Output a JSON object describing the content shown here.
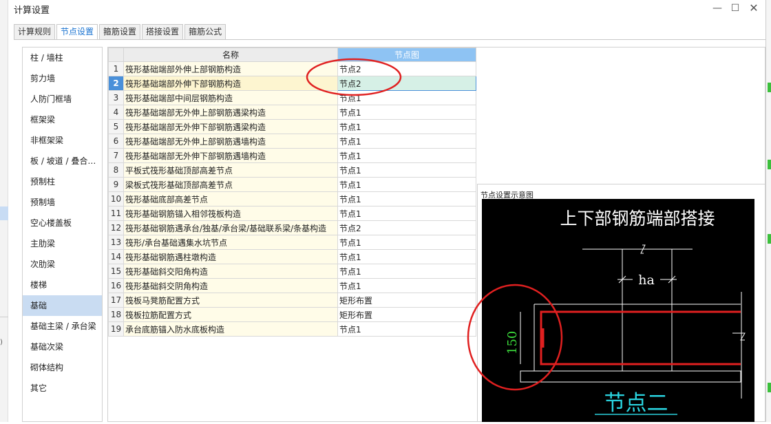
{
  "window": {
    "title": "计算设置"
  },
  "tabs": [
    "计算规则",
    "节点设置",
    "箍筋设置",
    "搭接设置",
    "箍筋公式"
  ],
  "sidebar": [
    "柱 / 墙柱",
    "剪力墙",
    "人防门框墙",
    "框架梁",
    "非框架梁",
    "板 / 坡道 / 叠合…",
    "预制柱",
    "预制墙",
    "空心楼盖板",
    "主肋梁",
    "次肋梁",
    "楼梯",
    "基础",
    "基础主梁 / 承台梁",
    "基础次梁",
    "砌体结构",
    "其它"
  ],
  "grid": {
    "headers": {
      "name": "名称",
      "value": "节点图"
    },
    "rows": [
      {
        "n": "1",
        "name": "筏形基础端部外伸上部钢筋构造",
        "value": "节点2"
      },
      {
        "n": "2",
        "name": "筏形基础端部外伸下部钢筋构造",
        "value": "节点2"
      },
      {
        "n": "3",
        "name": "筏形基础端部中间层钢筋构造",
        "value": "节点1"
      },
      {
        "n": "4",
        "name": "筏形基础端部无外伸上部钢筋遇梁构造",
        "value": "节点1"
      },
      {
        "n": "5",
        "name": "筏形基础端部无外伸下部钢筋遇梁构造",
        "value": "节点1"
      },
      {
        "n": "6",
        "name": "筏形基础端部无外伸上部钢筋遇墙构造",
        "value": "节点1"
      },
      {
        "n": "7",
        "name": "筏形基础端部无外伸下部钢筋遇墙构造",
        "value": "节点1"
      },
      {
        "n": "8",
        "name": "平板式筏形基础顶部高差节点",
        "value": "节点1"
      },
      {
        "n": "9",
        "name": "梁板式筏形基础顶部高差节点",
        "value": "节点1"
      },
      {
        "n": "10",
        "name": "筏形基础底部高差节点",
        "value": "节点1"
      },
      {
        "n": "11",
        "name": "筏形基础钢筋锚入相邻筏板构造",
        "value": "节点1"
      },
      {
        "n": "12",
        "name": "筏形基础钢筋遇承台/独基/承台梁/基础联系梁/条基构造",
        "value": "节点2"
      },
      {
        "n": "13",
        "name": "筏形/承台基础遇集水坑节点",
        "value": "节点1"
      },
      {
        "n": "14",
        "name": "筏形基础钢筋遇柱墩构造",
        "value": "节点1"
      },
      {
        "n": "15",
        "name": "筏形基础斜交阳角构造",
        "value": "节点1"
      },
      {
        "n": "16",
        "name": "筏形基础斜交阴角构造",
        "value": "节点1"
      },
      {
        "n": "17",
        "name": "筏板马凳筋配置方式",
        "value": "矩形布置"
      },
      {
        "n": "18",
        "name": "筏板拉筋配置方式",
        "value": "矩形布置"
      },
      {
        "n": "19",
        "name": "承台底筋锚入防水底板构造",
        "value": "节点1"
      }
    ]
  },
  "diagram": {
    "section_label": "节点设置示意图",
    "title": "上下部钢筋端部搭接",
    "dim_ha": "ha",
    "dim_150": "150",
    "caption": "节点二"
  },
  "colors": {
    "accent": "#1a73d1",
    "header_selected": "#8ec3f3",
    "annotation": "#e02020"
  }
}
